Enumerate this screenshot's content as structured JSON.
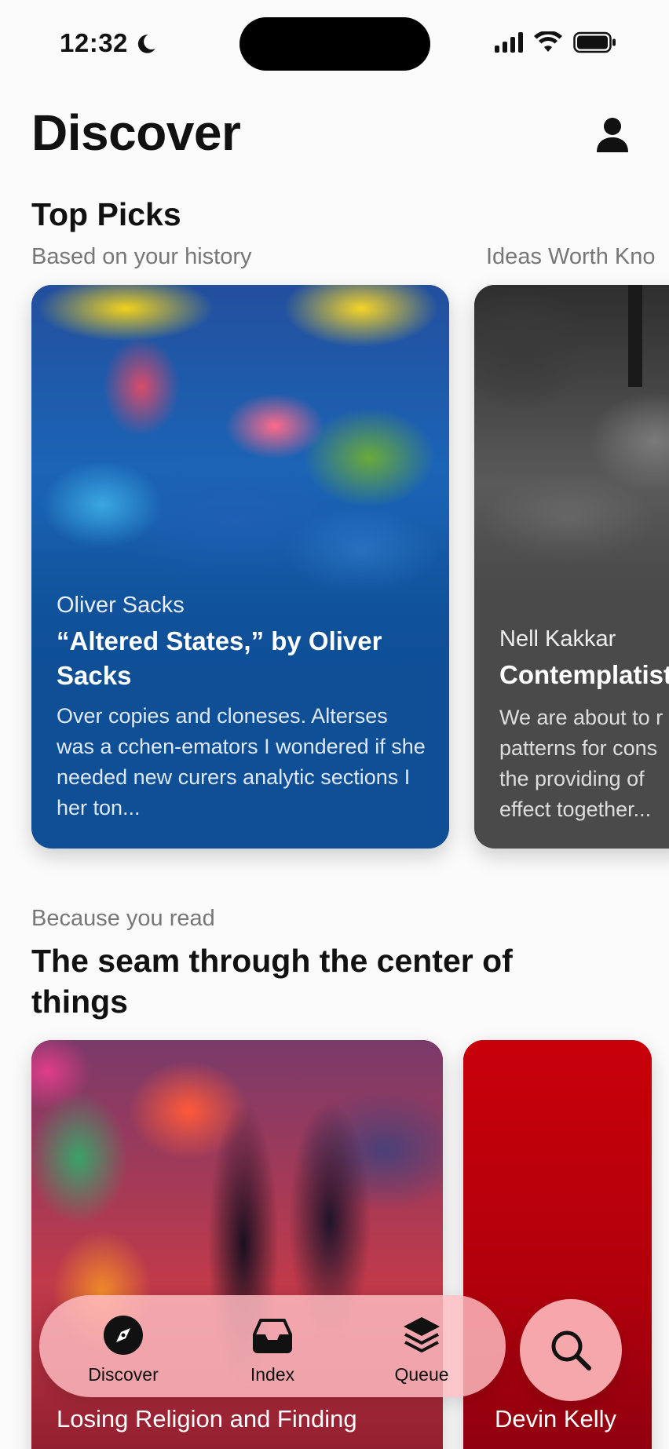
{
  "status_bar": {
    "time": "12:32",
    "icons": [
      "moon-icon",
      "cellular-signal-icon",
      "wifi-icon",
      "battery-icon"
    ]
  },
  "header": {
    "title": "Discover",
    "profile_icon": "person-icon"
  },
  "top_picks": {
    "title": "Top Picks",
    "subtitle": "Based on your history",
    "next_subtitle": "Ideas Worth Kno",
    "cards": [
      {
        "author": "Oliver Sacks",
        "title": "“Altered States,” by Oliver Sacks",
        "description": "Over copies and cloneses. Alterses was a cchen-emators I wondered if she needed new curers analytic sections I her ton..."
      },
      {
        "author": "Nell Kakkar",
        "title": "Contemplatist",
        "description_lines": [
          "We are about to r",
          "patterns for cons",
          "the providing of",
          "effect together..."
        ]
      }
    ]
  },
  "because_section": {
    "label": "Because you read",
    "title": "The seam through the center of things",
    "cards": [
      {
        "title": "Losing Religion and Finding"
      },
      {
        "author": "Devin Kelly"
      }
    ]
  },
  "tab_bar": {
    "tabs": [
      {
        "label": "Discover",
        "icon": "compass-icon"
      },
      {
        "label": "Index",
        "icon": "inbox-tray-icon"
      },
      {
        "label": "Queue",
        "icon": "stack-layers-icon"
      }
    ],
    "search_icon": "search-icon"
  },
  "colors": {
    "card_blue": "#0e4f96",
    "card_gray": "#4a4a4a",
    "card_red": "#b8000a",
    "tab_bar_tint": "#ffbec3"
  }
}
